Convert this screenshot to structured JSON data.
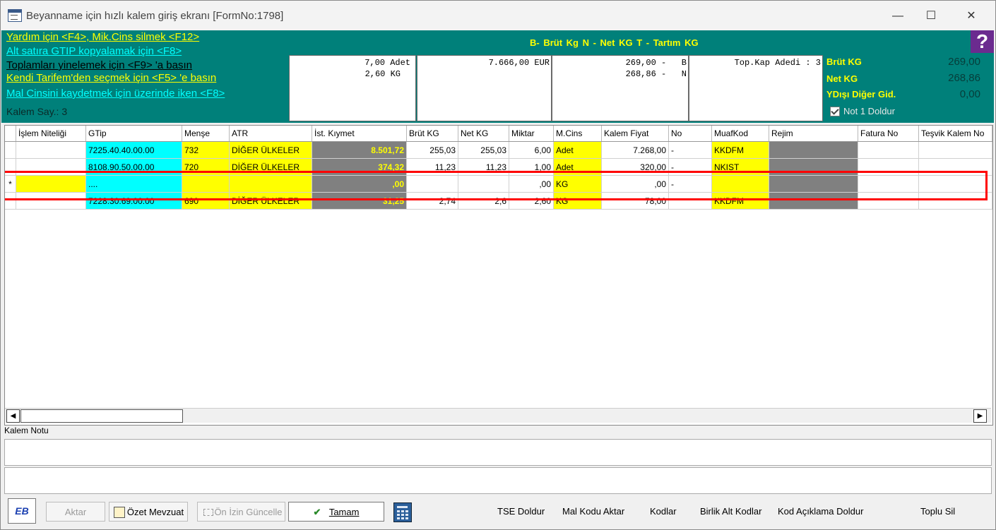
{
  "window": {
    "title": "Beyanname için hızlı kalem giriş ekranı [FormNo:1798]",
    "min_glyph": "—",
    "max_glyph": "☐",
    "close_glyph": "✕"
  },
  "help": {
    "line1": "Yardım için <F4>, Mik.Cins silmek <F12>",
    "line2": "Alt satıra GTIP kopyalamak için <F8>",
    "line3": "Toplamları yinelemek için <F9> 'a basın",
    "line4": "Kendi Tarifem'den seçmek  için <F5> 'e basın",
    "line5": "Mal Cinsini kaydetmek için üzerinde iken <F8>",
    "kalem_say": "Kalem Say.: 3",
    "legend": "B- Brüt Kg   N - Net KG   T - Tartım KG",
    "question_mark": "?"
  },
  "totals": {
    "box1_line1": "7,00 Adet",
    "box1_line2": "2,60 KG",
    "box2_line1": "7.666,00 EUR",
    "box3_line1": "269,00 -   B",
    "box3_line2": "268,86 -   N",
    "box4_line1": "Top.Kap Adedi : 3"
  },
  "right_summary": {
    "brut_label": "Brüt KG",
    "brut_value": "269,00",
    "net_label": "Net KG",
    "net_value": "268,86",
    "ydisi_label": "YDışı Diğer Gid.",
    "ydisi_value": "0,00",
    "not1_label": "Not 1 Doldur",
    "not1_checked": true
  },
  "grid": {
    "headers": [
      "İşlem Niteliği",
      "GTip",
      "Menşe",
      "ATR",
      "İst. Kıymet",
      "Brüt KG",
      "Net KG",
      "Miktar",
      "M.Cins",
      "Kalem Fiyat",
      "No",
      "MuafKod",
      "Rejim",
      "Fatura No",
      "Teşvik Kalem No"
    ],
    "rows": [
      {
        "marker": "",
        "islem": "",
        "gtip": "7225.40.40.00.00",
        "mense": "732",
        "atr": "DİĞER ÜLKELER",
        "kiymet": "8.501,72",
        "brut": "255,03",
        "net": "255,03",
        "miktar": "6,00",
        "mcins": "Adet",
        "fiyat": "7.268,00",
        "no": "-",
        "muaf": "KKDFM",
        "rejim": "",
        "fatura": "",
        "tesvik": ""
      },
      {
        "marker": "",
        "islem": "",
        "gtip": "8108.90.50.00.00",
        "mense": "720",
        "atr": "DİĞER ÜLKELER",
        "kiymet": "374,32",
        "brut": "11,23",
        "net": "11,23",
        "miktar": "1,00",
        "mcins": "Adet",
        "fiyat": "320,00",
        "no": "-",
        "muaf": "NKIST",
        "rejim": "",
        "fatura": "",
        "tesvik": ""
      },
      {
        "marker": "*",
        "islem": "",
        "gtip": "....",
        "mense": "",
        "atr": "",
        "kiymet": ",00",
        "brut": "",
        "net": "",
        "miktar": ",00",
        "mcins": "KG",
        "fiyat": ",00",
        "no": "-",
        "muaf": "",
        "rejim": "",
        "fatura": "",
        "tesvik": ""
      },
      {
        "marker": "",
        "islem": "",
        "gtip": "7228.30.69.00.00",
        "mense": "690",
        "atr": "DİĞER ÜLKELER",
        "kiymet": "31,25",
        "brut": "2,74",
        "net": "2,6",
        "miktar": "2,60",
        "mcins": "KG",
        "fiyat": "78,00",
        "no": "",
        "muaf": "KKDFM",
        "rejim": "",
        "fatura": "",
        "tesvik": ""
      }
    ]
  },
  "scroll": {
    "left": "◀",
    "right": "▶"
  },
  "notes": {
    "label": "Kalem Notu",
    "note1": "",
    "note2": ""
  },
  "buttons": {
    "eb": "EB",
    "aktar": "Aktar",
    "ozet": "Özet Mevzuat",
    "on_izin": "Ön İzin Güncelle",
    "tamam": "Tamam",
    "tse": "TSE Doldur",
    "mal_kodu": "Mal Kodu Aktar",
    "kodlar": "Kodlar",
    "birlik": "Birlik Alt Kodlar",
    "kod_aciklama": "Kod Açıklama Doldur",
    "toplu_sil": "Toplu Sil"
  }
}
